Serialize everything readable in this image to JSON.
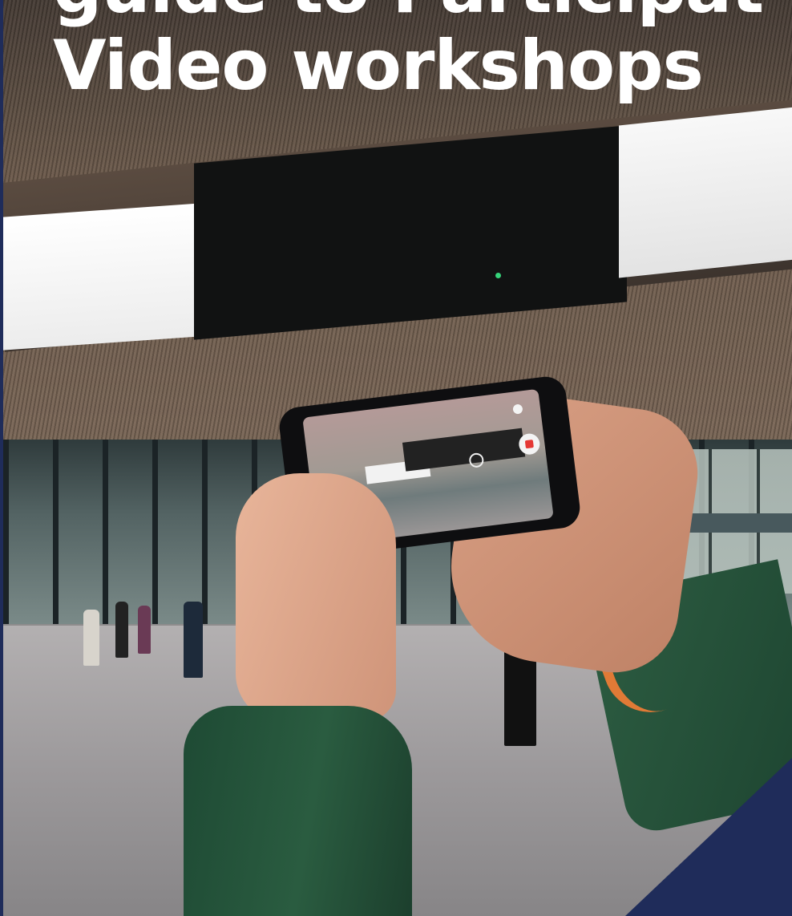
{
  "title": {
    "line1": "guide to Participat",
    "line2": "Video workshops"
  },
  "colors": {
    "navy": "#1f2c5a",
    "title_text": "#ffffff",
    "jacket_green": "#2a5c40",
    "cuff_orange": "#e07a36"
  }
}
